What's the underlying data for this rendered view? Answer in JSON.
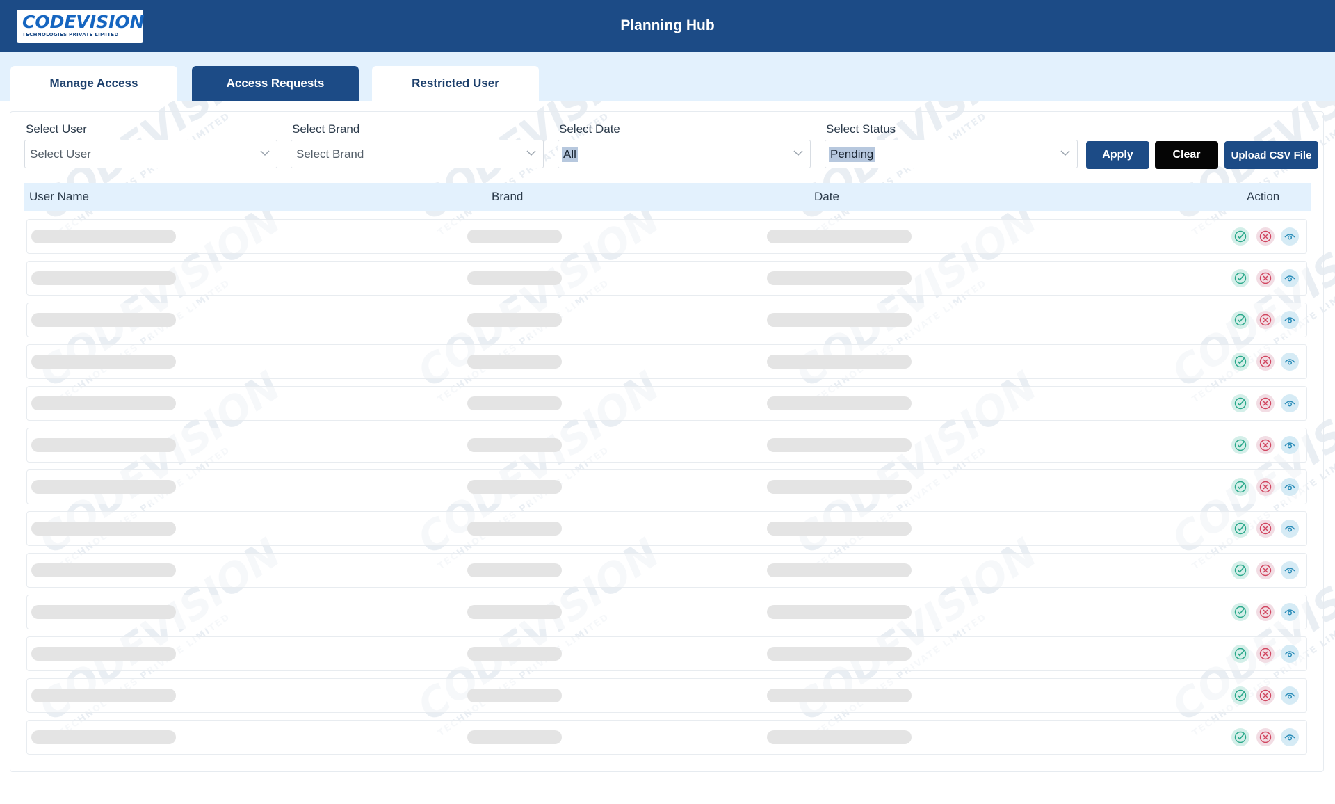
{
  "brand": {
    "logo_word": "CODEVISION",
    "logo_sub": "TECHNOLOGIES PRIVATE LIMITED",
    "primary_color": "#1c4b86",
    "accent_color": "#e3f1fd"
  },
  "header": {
    "title": "Planning Hub"
  },
  "tabs": [
    {
      "label": "Manage Access",
      "active": false
    },
    {
      "label": "Access Requests",
      "active": true
    },
    {
      "label": "Restricted User",
      "active": false
    }
  ],
  "filters": {
    "user": {
      "label": "Select User",
      "value": "Select User"
    },
    "brand": {
      "label": "Select Brand",
      "value": "Select Brand"
    },
    "date": {
      "label": "Select Date",
      "value": "All"
    },
    "status": {
      "label": "Select Status",
      "value": "Pending"
    }
  },
  "buttons": {
    "apply": "Apply",
    "clear": "Clear",
    "upload": "Upload CSV File"
  },
  "table": {
    "headers": [
      "User Name",
      "Brand",
      "Date",
      "Action"
    ],
    "loading": true,
    "row_count": 13,
    "action_icons": [
      "approve-check-icon",
      "reject-x-icon",
      "view-eye-icon"
    ],
    "colors": {
      "approve": "#2aa88a",
      "reject": "#d0455f",
      "view": "#2a8cb8"
    }
  }
}
